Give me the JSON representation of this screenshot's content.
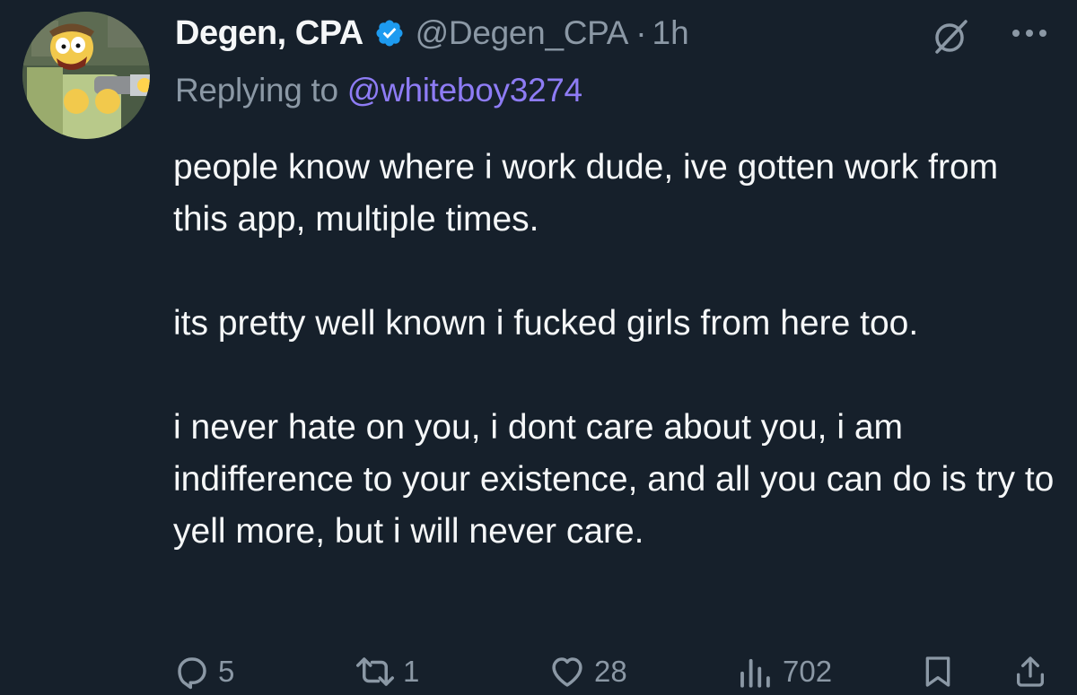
{
  "tweet": {
    "display_name": "Degen, CPA",
    "handle": "@Degen_CPA",
    "separator": "·",
    "time": "1h",
    "replying_prefix": "Replying to",
    "replying_to": "@whiteboy3274",
    "paragraphs": [
      "people know where i work dude, ive gotten work from this app, multiple times.",
      "its pretty well known i fucked girls from here too.",
      "i never hate on you, i dont care about you, i am indifference to your existence, and all you can do is try to yell more, but i will never care."
    ]
  },
  "actions": {
    "replies": "5",
    "reposts": "1",
    "likes": "28",
    "views": "702"
  },
  "icons": {
    "verified": "verified-badge-icon",
    "grok": "grok-icon",
    "more": "more-icon",
    "reply": "reply-icon",
    "repost": "repost-icon",
    "like": "heart-icon",
    "views": "views-icon",
    "bookmark": "bookmark-icon",
    "share": "share-icon"
  },
  "colors": {
    "background": "#16202b",
    "text": "#f5f7f8",
    "muted": "#8b98a5",
    "mention": "#8e7cf5",
    "verified": "#1d9bf0"
  }
}
